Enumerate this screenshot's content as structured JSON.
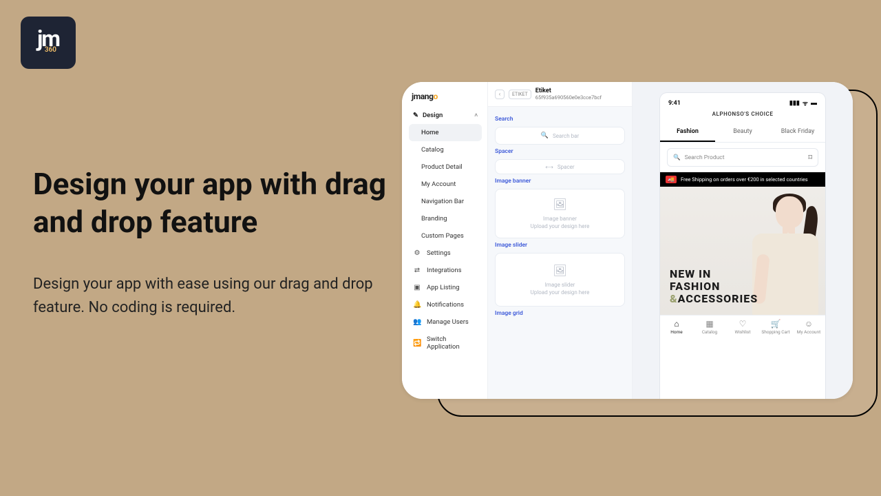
{
  "logo": {
    "text": "jm",
    "sub": "360"
  },
  "marketing": {
    "headline": "Design your app with drag and drop feature",
    "sub": "Design your app with ease using our drag and drop feature. No coding is required."
  },
  "sidebar": {
    "brand": "jmango",
    "section": "Design",
    "design_items": [
      "Home",
      "Catalog",
      "Product Detail",
      "My Account",
      "Navigation Bar",
      "Branding",
      "Custom Pages"
    ],
    "other_items": [
      "Settings",
      "Integrations",
      "App Listing",
      "Notifications",
      "Manage Users",
      "Switch Application"
    ]
  },
  "header": {
    "chip": "ETIKET",
    "title": "Etiket",
    "id": "65f935a690560e0e3cce7bcf"
  },
  "blocks": {
    "search": {
      "label": "Search",
      "placeholder": "Search bar"
    },
    "spacer": {
      "label": "Spacer",
      "text": "Spacer"
    },
    "banner": {
      "label": "Image banner",
      "title": "Image banner",
      "hint": "Upload your design here"
    },
    "slider": {
      "label": "Image slider",
      "title": "Image slider",
      "hint": "Upload your design here"
    },
    "grid": {
      "label": "Image grid"
    }
  },
  "phone": {
    "time": "9:41",
    "brand": "ALPHONSO'S CHOICE",
    "tabs": [
      "Fashion",
      "Beauty",
      "Black Friday"
    ],
    "search_placeholder": "Search Product",
    "ship": "Free Shipping on orders over €200 in selected countries",
    "hero_l1": "NEW IN",
    "hero_l2": "FASHION",
    "hero_l3_amp": "&",
    "hero_l3_rest": "ACCESSORIES",
    "tabbar": [
      "Home",
      "Catalog",
      "Wishlist",
      "Shopping Cart",
      "My Account"
    ]
  }
}
